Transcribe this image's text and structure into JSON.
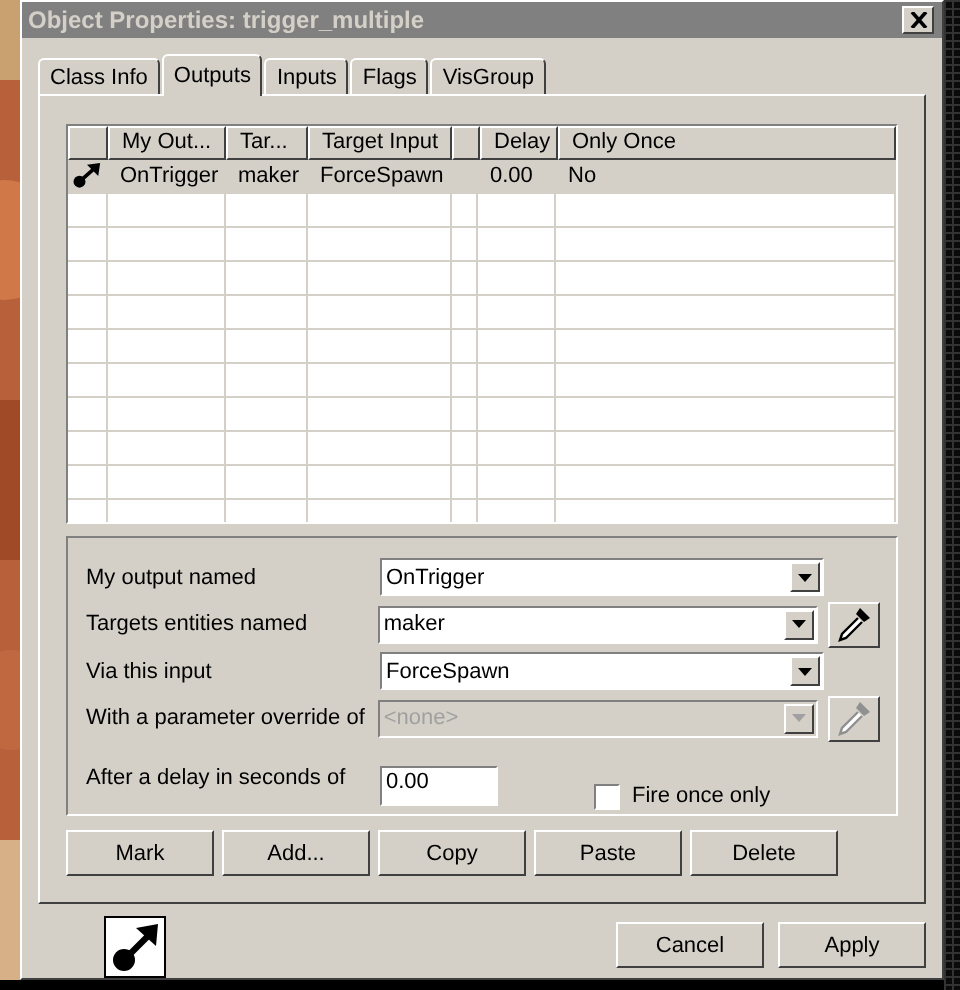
{
  "window": {
    "title": "Object Properties: trigger_multiple",
    "active": false
  },
  "tabs": [
    {
      "label": "Class Info",
      "selected": false
    },
    {
      "label": "Outputs",
      "selected": true
    },
    {
      "label": "Inputs",
      "selected": false
    },
    {
      "label": "Flags",
      "selected": false
    },
    {
      "label": "VisGroup",
      "selected": false
    }
  ],
  "table": {
    "columns": [
      "",
      "My Out...",
      "Tar...",
      "Target Input",
      "",
      "Delay",
      "Only Once"
    ],
    "rows": [
      {
        "selected": true,
        "cells": [
          "",
          "OnTrigger",
          "maker",
          "ForceSpawn",
          "",
          "0.00",
          "No"
        ]
      }
    ]
  },
  "form": {
    "fields": [
      {
        "kind": "combo",
        "label": "My output named",
        "value": "OnTrigger",
        "disabled": false,
        "picker": false
      },
      {
        "kind": "combo",
        "label": "Targets entities named",
        "value": "maker",
        "disabled": false,
        "picker": true
      },
      {
        "kind": "combo",
        "label": "Via this input",
        "value": "ForceSpawn",
        "disabled": false,
        "picker": false
      },
      {
        "kind": "combo",
        "label": "With a parameter override of",
        "value": "<none>",
        "disabled": true,
        "picker": true
      },
      {
        "kind": "text",
        "label": "After a delay in seconds of",
        "value": "0.00",
        "disabled": false
      }
    ],
    "checkbox": {
      "label": "Fire once only",
      "checked": false
    }
  },
  "actions": [
    "Mark",
    "Add...",
    "Copy",
    "Paste",
    "Delete"
  ],
  "buttons": [
    "Cancel",
    "Apply"
  ]
}
